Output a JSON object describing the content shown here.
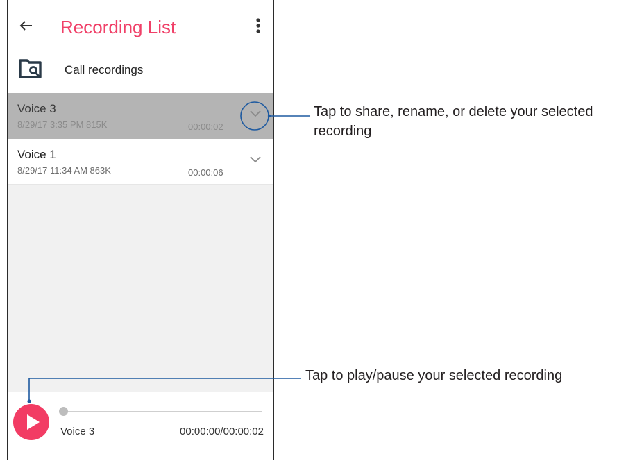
{
  "app": {
    "title": "Recording List",
    "back_icon": "arrow-left-icon",
    "menu_icon": "more-vertical-icon"
  },
  "folder": {
    "icon": "call-recording-folder-icon",
    "label": "Call recordings"
  },
  "recordings": [
    {
      "name": "Voice 3",
      "meta": "8/29/17 3:35 PM  815K",
      "duration": "00:00:02",
      "selected": true
    },
    {
      "name": "Voice 1",
      "meta": "8/29/17 11:34 AM  863K",
      "duration": "00:00:06",
      "selected": false
    }
  ],
  "player": {
    "track_name": "Voice 3",
    "time": "00:00:00/00:00:02",
    "progress": 0,
    "play_icon": "play-icon"
  },
  "callouts": {
    "expand_line1": "Tap to share, rename, or delete your selected",
    "expand_line2": "recording",
    "play": "Tap to play/pause your selected recording"
  },
  "colors": {
    "accent": "#f04068",
    "play_button": "#f23c64",
    "callout_line": "#1e5aa0",
    "selected_row": "#b4b4b4"
  }
}
